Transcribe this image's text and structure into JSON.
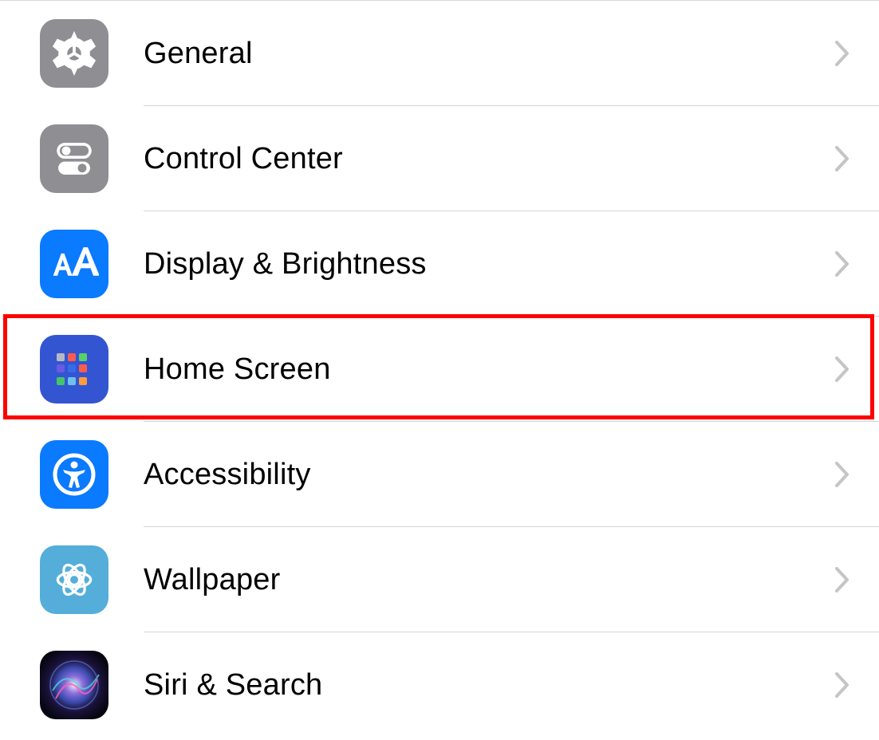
{
  "settings": {
    "items": [
      {
        "label": "General"
      },
      {
        "label": "Control Center"
      },
      {
        "label": "Display & Brightness"
      },
      {
        "label": "Home Screen"
      },
      {
        "label": "Accessibility"
      },
      {
        "label": "Wallpaper"
      },
      {
        "label": "Siri & Search"
      }
    ]
  },
  "annotation": {
    "highlighted_item": "Home Screen"
  }
}
